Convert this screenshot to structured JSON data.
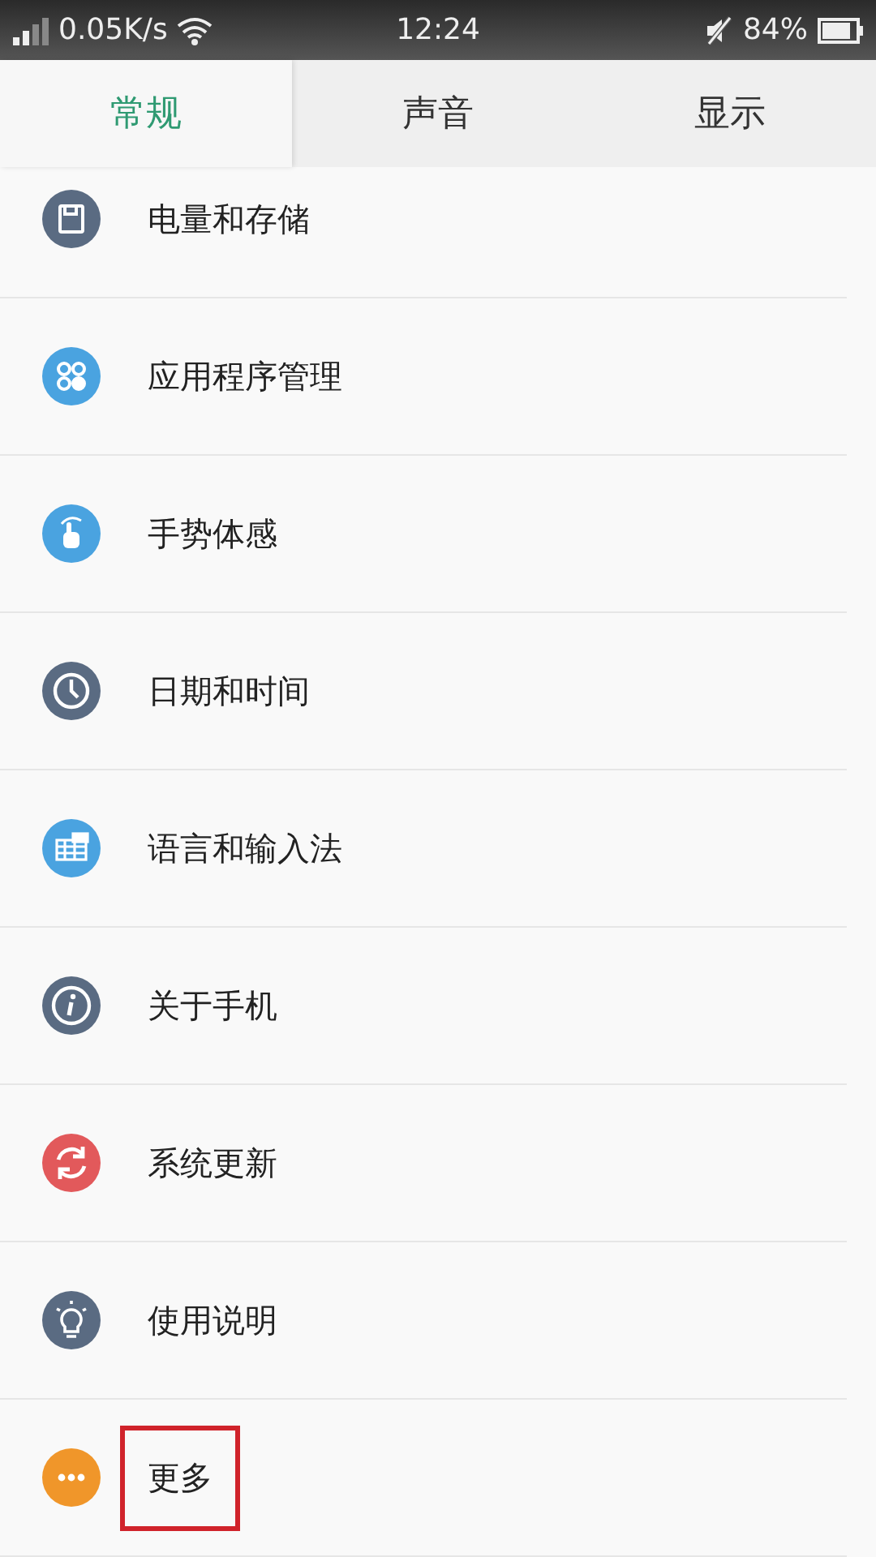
{
  "status_bar": {
    "speed": "0.05K/s",
    "time": "12:24",
    "battery": "84%"
  },
  "tabs": [
    {
      "label": "常规",
      "selected": true
    },
    {
      "label": "声音",
      "selected": false
    },
    {
      "label": "显示",
      "selected": false
    }
  ],
  "items": [
    {
      "label": "电量和存储",
      "kind": "storage",
      "color": "#5a6b82",
      "highlighted": false
    },
    {
      "label": "应用程序管理",
      "kind": "apps",
      "color": "#4aa3e0",
      "highlighted": false
    },
    {
      "label": "手势体感",
      "kind": "gesture",
      "color": "#4aa3e0",
      "highlighted": false
    },
    {
      "label": "日期和时间",
      "kind": "clock",
      "color": "#5a6b82",
      "highlighted": false
    },
    {
      "label": "语言和输入法",
      "kind": "keyboard",
      "color": "#4aa3e0",
      "highlighted": false
    },
    {
      "label": "关于手机",
      "kind": "info",
      "color": "#5a6b82",
      "highlighted": false
    },
    {
      "label": "系统更新",
      "kind": "update",
      "color": "#e2595b",
      "highlighted": false
    },
    {
      "label": "使用说明",
      "kind": "bulb",
      "color": "#5a6b82",
      "highlighted": false
    },
    {
      "label": "更多",
      "kind": "more",
      "color": "#f0962a",
      "highlighted": true
    }
  ]
}
